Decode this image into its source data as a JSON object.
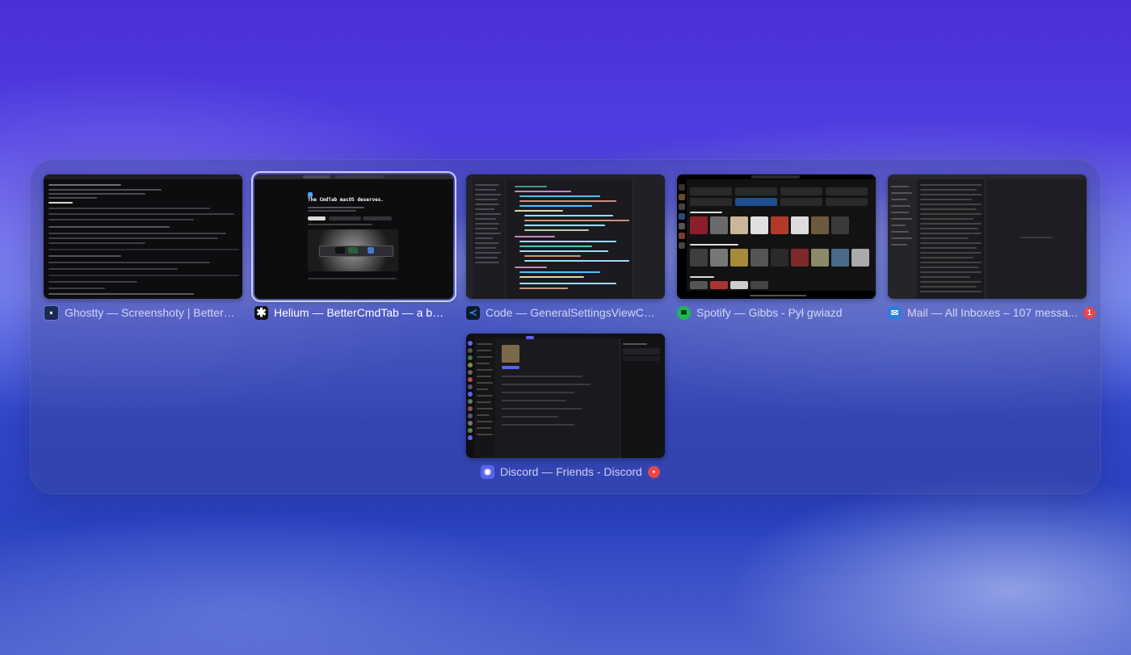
{
  "windows": [
    {
      "app": "Ghostty",
      "title": "Ghostty — Screenshoty | BetterC...",
      "icon": "ghostty-icon",
      "badge": ""
    },
    {
      "app": "Helium",
      "title": "Helium — BetterCmdTab — a bett...",
      "icon": "helium-icon",
      "badge": "",
      "selected": true,
      "preview_heading": "The CmdTab macOS deserves."
    },
    {
      "app": "Code",
      "title": "Code — GeneralSettingsViewCont...",
      "icon": "vscode-icon",
      "badge": ""
    },
    {
      "app": "Spotify",
      "title": "Spotify — Gibbs - Pył gwiazd",
      "icon": "spotify-icon",
      "badge": ""
    },
    {
      "app": "Mail",
      "title": "Mail — All Inboxes – 107 messa...",
      "icon": "mail-icon",
      "badge": "1"
    },
    {
      "app": "Discord",
      "title": "Discord — Friends - Discord",
      "icon": "discord-icon",
      "badge": "•"
    }
  ],
  "colors": {
    "badge": "#e5484d",
    "spotify": "#1db954",
    "vscode": "#2f8fe6",
    "discord": "#5865f2",
    "mail": "#2f7de1"
  }
}
